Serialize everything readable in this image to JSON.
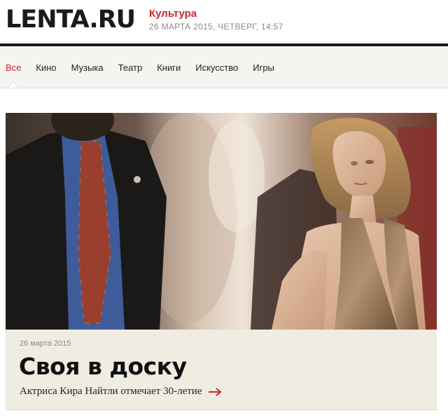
{
  "header": {
    "logo": "LENTA.RU",
    "section": "Культура",
    "date": "26 МАРТА 2015, ЧЕТВЕРГ, 14:57"
  },
  "nav": {
    "items": [
      {
        "label": "Все",
        "active": true
      },
      {
        "label": "Кино",
        "active": false
      },
      {
        "label": "Музыка",
        "active": false
      },
      {
        "label": "Театр",
        "active": false
      },
      {
        "label": "Книги",
        "active": false
      },
      {
        "label": "Искусство",
        "active": false
      },
      {
        "label": "Игры",
        "active": false
      }
    ]
  },
  "story": {
    "date": "26 марта 2015",
    "title": "Своя в доску",
    "lead": "Актриса Кира Найтли отмечает 30-летие",
    "arrow_icon": "arrow-right-icon"
  },
  "colors": {
    "accent": "#c8282e",
    "nav_bg": "#f4f4f1",
    "caption_bg": "#efece1",
    "text": "#1a1a1a",
    "muted": "#8a8a8a"
  }
}
